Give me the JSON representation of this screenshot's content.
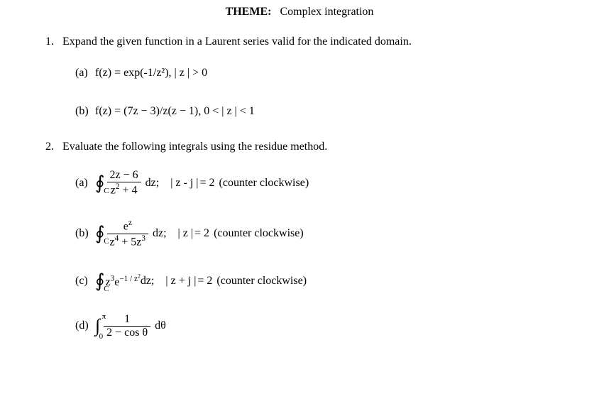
{
  "title": {
    "label": "THEME:",
    "text": "Complex integration"
  },
  "p1": {
    "num": "1.",
    "prompt": "Expand the given function in a Laurent series valid for the indicated domain.",
    "a": {
      "label": "(a)",
      "expr": "f(z) = exp(-1/z²),   | z | > 0"
    },
    "b": {
      "label": "(b)",
      "expr": "f(z) = (7z − 3)/z(z − 1),   0 < | z | < 1"
    }
  },
  "p2": {
    "num": "2.",
    "prompt": "Evaluate the following integrals using the residue method.",
    "a": {
      "label": "(a)",
      "int_sub": "C",
      "frac_num": "2z − 6",
      "frac_den_a": "z",
      "frac_den_exp": "2",
      "frac_den_b": " + 4",
      "dz": "dz;",
      "cond_lhs": "z - j",
      "cond_rhs": "= 2",
      "desc": "(counter clockwise)"
    },
    "b": {
      "label": "(b)",
      "int_sub": "C",
      "num_base": "e",
      "num_exp": "z",
      "den_a": "z",
      "den_a_exp": "4",
      "den_mid": " + 5z",
      "den_b_exp": "3",
      "dz": "dz;",
      "cond_lhs": "z",
      "cond_rhs": "= 2",
      "desc": "(counter clockwise)"
    },
    "c": {
      "label": "(c)",
      "int_sub": "C",
      "a": "z",
      "a_exp": "3",
      "b": "e",
      "b_exp": "−1 / z",
      "b_exp2": "2",
      "dz": " dz;",
      "cond_lhs": "z + j",
      "cond_rhs": "= 2",
      "desc": "(counter clockwise)"
    },
    "d": {
      "label": "(d)",
      "ub": "π",
      "lb": "0",
      "num": "1",
      "den": "2 − cos θ",
      "dth": "dθ"
    }
  }
}
